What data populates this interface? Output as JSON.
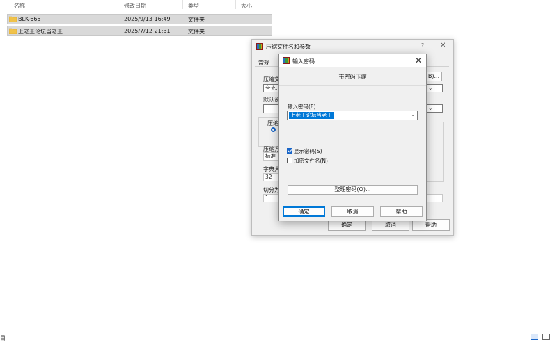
{
  "explorer": {
    "columns": [
      "名称",
      "修改日期",
      "类型",
      "大小"
    ],
    "rows": [
      {
        "name": "BLK-665",
        "date": "2025/9/13 16:49",
        "type": "文件夹"
      },
      {
        "name": "上老王论坛当老王",
        "date": "2025/7/12 21:31",
        "type": "文件夹"
      }
    ],
    "status_fragment": "目"
  },
  "archive_dialog": {
    "title": "压缩文件名和参数",
    "help_glyph": "?",
    "close_glyph": "✕",
    "tab_general": "常规",
    "archive_name_label": "压缩文",
    "archive_name_value": "夸克.r",
    "default_profile_label": "默认设",
    "browse_label": "B)...",
    "format_label": "压缩文",
    "method_label": "压缩方",
    "method_value": "标准",
    "dict_label": "字典大",
    "dict_value": "32",
    "split_label": "切分为",
    "split_value": "1",
    "ok": "确定",
    "cancel": "取消",
    "help": "帮助"
  },
  "password_dialog": {
    "title": "输入密码",
    "close_glyph": "✕",
    "heading": "带密码压缩",
    "password_label": "输入密码(E)",
    "password_value": "上老王论坛当老王",
    "show_password": {
      "label": "显示密码(S)",
      "checked": true
    },
    "encrypt_names": {
      "label": "加密文件名(N)",
      "checked": false
    },
    "organize_button": "整理密码(O)...",
    "ok": "确定",
    "cancel": "取消",
    "help": "帮助",
    "caret_glyph": "⌄"
  },
  "colors": {
    "selection": "#0078d7",
    "row_bg": "#d9d9d9",
    "folder": "#f0c24a"
  }
}
